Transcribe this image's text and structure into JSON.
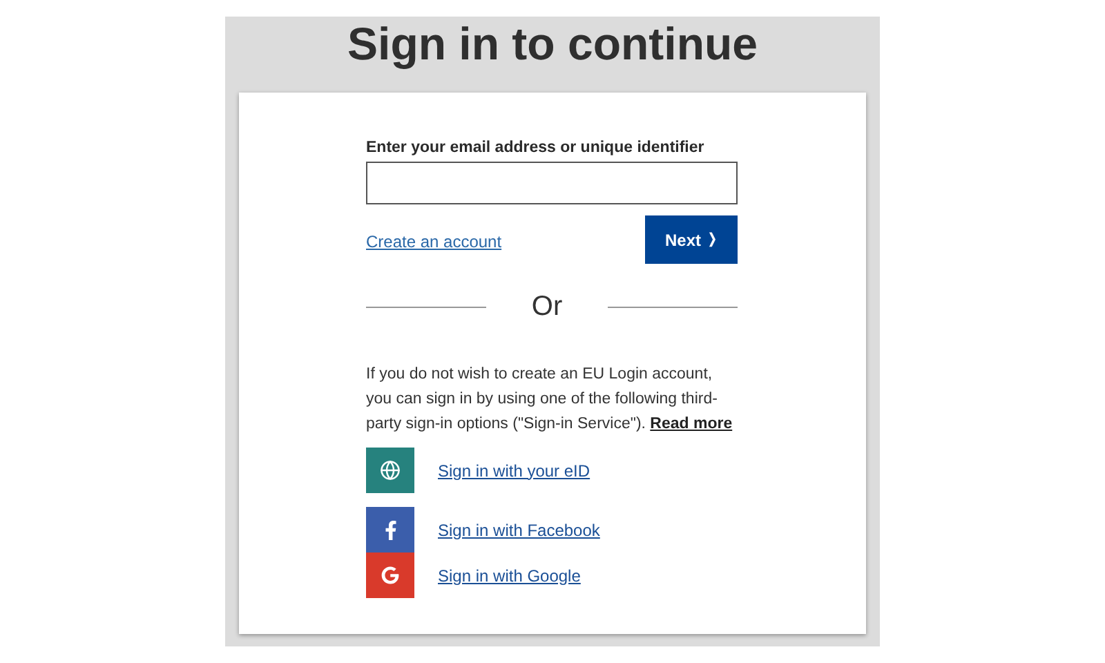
{
  "title": "Sign in to continue",
  "email_field": {
    "label": "Enter your email address or unique identifier"
  },
  "create_account": "Create an account",
  "next_button": {
    "label": "Next",
    "chevron": "❭"
  },
  "separator": "Or",
  "info": {
    "text": "If you do not wish to create an EU Login account, you can sign in by using one of the following third-party sign-in options (\"Sign-in Service\").",
    "link": "Read more"
  },
  "providers": [
    {
      "kind": "eid",
      "color": "#26827e",
      "label": "Sign in with your eID"
    },
    {
      "kind": "facebook",
      "color": "#3b5eab",
      "label": "Sign in with Facebook"
    },
    {
      "kind": "google",
      "color": "#d93a2b",
      "label": "Sign in with Google"
    }
  ]
}
